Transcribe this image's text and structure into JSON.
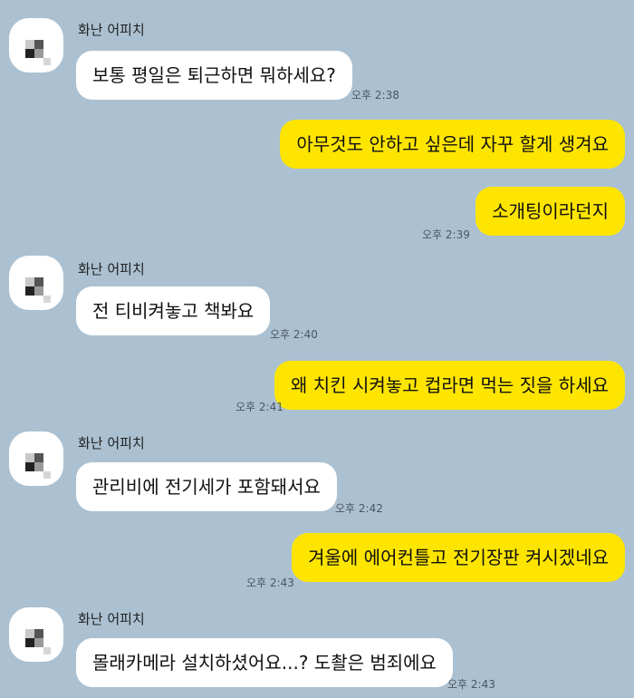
{
  "contact_name": "화난 어피치",
  "colors": {
    "background": "#abc1d1",
    "incoming_bubble": "#ffffff",
    "outgoing_bubble": "#fee500"
  },
  "messages": [
    {
      "sender": "화난 어피치",
      "text": "보통 평일은 퇴근하면 뭐하세요?",
      "time": "오후 2:38"
    },
    {
      "sender": "me",
      "text": "아무것도 안하고 싶은데 자꾸 할게 생겨요",
      "time": ""
    },
    {
      "sender": "me",
      "text": "소개팅이라던지",
      "time": "오후 2:39"
    },
    {
      "sender": "화난 어피치",
      "text": "전 티비켜놓고 책봐요",
      "time": "오후 2:40"
    },
    {
      "sender": "me",
      "text": "왜 치킨 시켜놓고 컵라면 먹는 짓을 하세요",
      "time": "오후 2:41"
    },
    {
      "sender": "화난 어피치",
      "text": "관리비에 전기세가 포함돼서요",
      "time": "오후 2:42"
    },
    {
      "sender": "me",
      "text": "겨울에 에어컨틀고 전기장판 켜시겠네요",
      "time": "오후 2:43"
    },
    {
      "sender": "화난 어피치",
      "text": "몰래카메라 설치하셨어요...? 도촬은 범죄에요",
      "time": "오후 2:43"
    }
  ]
}
